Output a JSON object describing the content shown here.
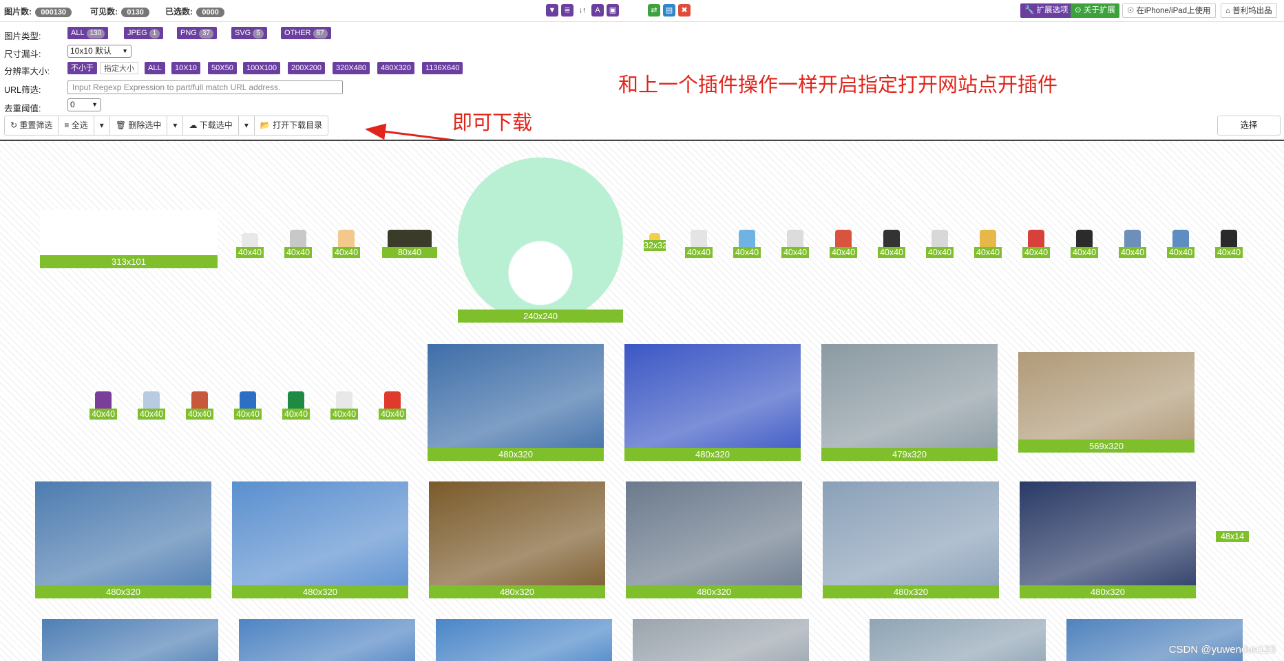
{
  "topbar": {
    "stats": [
      {
        "label": "图片数:",
        "value": "000130"
      },
      {
        "label": "可见数:",
        "value": "0130"
      },
      {
        "label": "已选数:",
        "value": "0000"
      }
    ],
    "center_icons": [
      {
        "icon": "funnel-icon",
        "glyph": "▼"
      },
      {
        "icon": "list-icon",
        "glyph": "≣"
      },
      {
        "icon": "sort-icon",
        "glyph": "↓↑"
      },
      {
        "icon": "font-icon",
        "glyph": "A"
      },
      {
        "icon": "picture-icon",
        "glyph": "▣"
      },
      {
        "icon": "swap-icon",
        "glyph": "⇄"
      },
      {
        "icon": "file-icon",
        "glyph": "▤"
      },
      {
        "icon": "close-icon",
        "glyph": "✖"
      }
    ],
    "right_buttons": [
      {
        "label": "扩展选项",
        "glyph": "🔧"
      },
      {
        "label": "关于扩展",
        "glyph": "⊙"
      },
      {
        "label": "在iPhone/iPad上使用",
        "glyph": "☉"
      },
      {
        "label": "普利坞出品",
        "glyph": "⌂"
      }
    ]
  },
  "filters": {
    "type_label": "图片类型:",
    "types": [
      {
        "label": "ALL",
        "count": "130"
      },
      {
        "label": "JPEG",
        "count": "1"
      },
      {
        "label": "PNG",
        "count": "37"
      },
      {
        "label": "SVG",
        "count": "5"
      },
      {
        "label": "OTHER",
        "count": "87"
      }
    ],
    "size_label": "尺寸漏斗:",
    "size_value": "10x10 默认",
    "res_label": "分辨率大小:",
    "res_mode": [
      "不小于",
      "指定大小"
    ],
    "res_options": [
      "ALL",
      "10X10",
      "50X50",
      "100X100",
      "200X200",
      "320X480",
      "480X320",
      "1136X640"
    ],
    "url_label": "URL筛选:",
    "url_placeholder": "Input Regexp Expression to part/full match URL address.",
    "dedupe_label": "去重阈值:",
    "dedupe_value": "0"
  },
  "toolbar": {
    "buttons": [
      {
        "icon": "refresh-icon",
        "glyph": "↻",
        "label": "重置筛选"
      },
      {
        "icon": "list-icon",
        "glyph": "≡",
        "label": "全选"
      },
      {
        "icon": "caret-down-icon",
        "glyph": "▾",
        "label": ""
      },
      {
        "icon": "trash-icon",
        "glyph": "🗑",
        "label": "删除选中"
      },
      {
        "icon": "caret-down-icon",
        "glyph": "▾",
        "label": ""
      },
      {
        "icon": "cloud-download-icon",
        "glyph": "☁",
        "label": "下载选中"
      },
      {
        "icon": "caret-down-icon",
        "glyph": "▾",
        "label": ""
      },
      {
        "icon": "folder-open-icon",
        "glyph": "📂",
        "label": "打开下载目录"
      }
    ],
    "select_label": "选择"
  },
  "annotations": {
    "download_note": "即可下载",
    "plugin_note": "和上一个插件操作一样开启指定打开网站点开插件",
    "color": "#e1251b"
  },
  "gallery": {
    "caption_color": "#7fbf2c",
    "items": [
      {
        "name": "qiantu-logo",
        "caption": "313x101",
        "color": "#2eb85c"
      },
      {
        "name": "guitar-icon",
        "caption": "40x40",
        "color": "#e8e8e8"
      },
      {
        "name": "building-icon",
        "caption": "40x40",
        "color": "#c8c8c8"
      },
      {
        "name": "folder-icon",
        "caption": "40x40",
        "color": "#f2c98a"
      },
      {
        "name": "upgrade-badge",
        "caption": "80x40",
        "color": "#3b3b2a"
      },
      {
        "name": "rabbit-mascot",
        "caption": "240x240",
        "color": "#b9efd3"
      },
      {
        "name": "gift-icon",
        "caption": "32x32",
        "color": "#f1d04a"
      },
      {
        "name": "bag-icon",
        "caption": "40x40",
        "color": "#e4e4e4"
      },
      {
        "name": "landscape-icon",
        "caption": "40x40",
        "color": "#6fb2e4"
      },
      {
        "name": "cart-icon",
        "caption": "40x40",
        "color": "#dcdcdc"
      },
      {
        "name": "powerpoint-icon",
        "caption": "40x40",
        "color": "#d9533f"
      },
      {
        "name": "clapper-icon",
        "caption": "40x40",
        "color": "#333333"
      },
      {
        "name": "box-icon",
        "caption": "40x40",
        "color": "#d8d8d8"
      },
      {
        "name": "frame-icon",
        "caption": "40x40",
        "color": "#e6b84a"
      },
      {
        "name": "giftbox-icon",
        "caption": "40x40",
        "color": "#d8413a"
      },
      {
        "name": "calculator-icon",
        "caption": "40x40",
        "color": "#2b2b2b"
      },
      {
        "name": "cool-icon",
        "caption": "40x40",
        "color": "#6d8fb8"
      },
      {
        "name": "ab-icon",
        "caption": "40x40",
        "color": "#5e8dc2"
      },
      {
        "name": "music-icon",
        "caption": "40x40",
        "color": "#2a2a2a"
      },
      {
        "name": "ball-icon",
        "caption": "40x40",
        "color": "#7a3d9a"
      },
      {
        "name": "card-icon",
        "caption": "40x40",
        "color": "#b8cbe0"
      },
      {
        "name": "house-icon",
        "caption": "40x40",
        "color": "#c7583c"
      },
      {
        "name": "word-icon",
        "caption": "40x40",
        "color": "#2c6fc4"
      },
      {
        "name": "excel-icon",
        "caption": "40x40",
        "color": "#1f8a44"
      },
      {
        "name": "document-icon",
        "caption": "40x40",
        "color": "#e8e8e8"
      },
      {
        "name": "apple-icon",
        "caption": "40x40",
        "color": "#e03a2c"
      },
      {
        "name": "skyscraper-photo",
        "caption": "480x320",
        "color": "#3e6ea8"
      },
      {
        "name": "fireworks-photo",
        "caption": "480x320",
        "color": "#3b57c4"
      },
      {
        "name": "expo-photo",
        "caption": "479x320",
        "color": "#8b9aa2"
      },
      {
        "name": "city-photo",
        "caption": "569x320",
        "color": "#b09a78"
      },
      {
        "name": "glass-tower-photo",
        "caption": "480x320",
        "color": "#4d7cb0"
      },
      {
        "name": "towers-sky-photo",
        "caption": "480x320",
        "color": "#5a8fcf"
      },
      {
        "name": "golden-water-photo",
        "caption": "480x320",
        "color": "#7a5a2a"
      },
      {
        "name": "sunset-towers-photo",
        "caption": "480x320",
        "color": "#6b7a8c"
      },
      {
        "name": "aerial-clouds-photo",
        "caption": "480x320",
        "color": "#8aa0b8"
      },
      {
        "name": "night-city-photo",
        "caption": "480x320",
        "color": "#2a3a66"
      },
      {
        "name": "tiny-image",
        "caption": "48x14",
        "color": "#7fbf2c"
      },
      {
        "name": "building-photo-a",
        "caption": "",
        "color": "#4f7fb5"
      },
      {
        "name": "building-photo-b",
        "caption": "",
        "color": "#4f84c3"
      },
      {
        "name": "building-photo-c",
        "caption": "",
        "color": "#4a86c8"
      },
      {
        "name": "street-photo",
        "caption": "",
        "color": "#9ba4ad"
      },
      {
        "name": "aerial-photo",
        "caption": "",
        "color": "#8fa4b4"
      },
      {
        "name": "building-photo-d",
        "caption": "",
        "color": "#5083bd"
      }
    ]
  },
  "watermark": "CSDN @yuwenduo123"
}
